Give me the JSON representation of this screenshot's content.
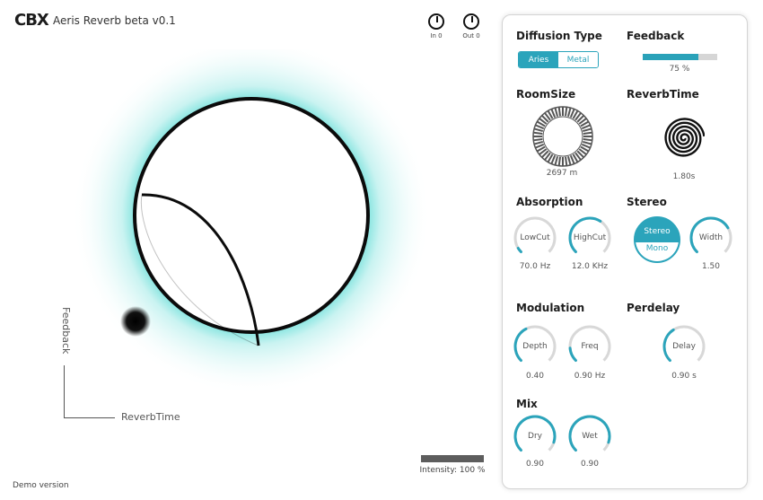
{
  "header": {
    "logo": "CBX",
    "title": "Aeris Reverb beta v0.1",
    "in_label": "In 0",
    "out_label": "Out 0"
  },
  "visualizer": {
    "y_axis_label": "Feedback",
    "x_axis_label": "ReverbTime",
    "intensity_label": "Intensity: 100 %",
    "intensity": 1.0,
    "accent_glow": "#8fe6e0"
  },
  "footer": {
    "demo": "Demo version"
  },
  "panel": {
    "diffusion": {
      "title": "Diffusion Type",
      "options": [
        "Aries",
        "Metal"
      ],
      "selected": "Aries"
    },
    "feedback": {
      "title": "Feedback",
      "value_text": "75 %",
      "value": 0.75
    },
    "roomsize": {
      "title": "RoomSize",
      "value_text": "2697 m"
    },
    "reverbtime": {
      "title": "ReverbTime",
      "value_text": "1.80s"
    },
    "absorption": {
      "title": "Absorption",
      "lowcut": {
        "label": "LowCut",
        "value_text": "70.0 Hz",
        "value": 0.05
      },
      "highcut": {
        "label": "HighCut",
        "value_text": "12.0 KHz",
        "value": 0.62
      }
    },
    "stereo": {
      "title": "Stereo",
      "mode_on": "Stereo",
      "mode_off": "Mono",
      "width": {
        "label": "Width",
        "value_text": "1.50",
        "value": 0.72
      }
    },
    "modulation": {
      "title": "Modulation",
      "depth": {
        "label": "Depth",
        "value_text": "0.40",
        "value": 0.4
      },
      "freq": {
        "label": "Freq",
        "value_text": "0.90 Hz",
        "value": 0.15
      }
    },
    "predelay": {
      "title": "Perdelay",
      "delay": {
        "label": "Delay",
        "value_text": "0.90 s",
        "value": 0.38
      }
    },
    "mix": {
      "title": "Mix",
      "dry": {
        "label": "Dry",
        "value_text": "0.90",
        "value": 0.9
      },
      "wet": {
        "label": "Wet",
        "value_text": "0.90",
        "value": 0.9
      }
    }
  },
  "colors": {
    "accent": "#2ba4bb",
    "track": "#d8d8d8"
  }
}
